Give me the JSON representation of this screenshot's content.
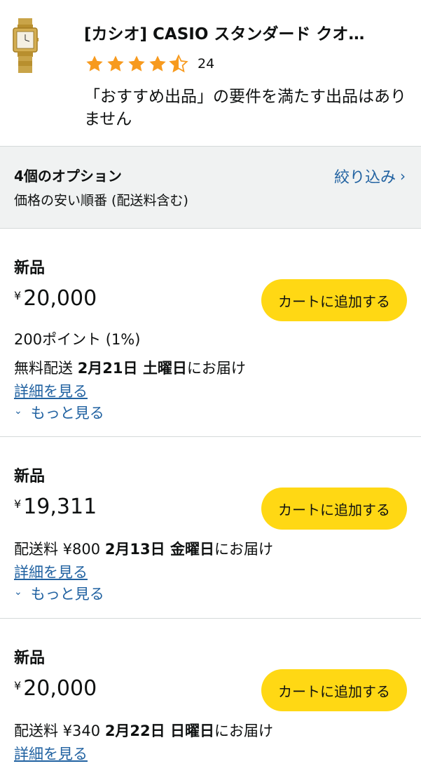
{
  "product": {
    "title": "[カシオ] CASIO スタンダード クオ…",
    "rating_count": "24",
    "rating_value": 4.5,
    "no_recommended": "「おすすめ出品」の要件を満たす出品はありません"
  },
  "options": {
    "count_label": "4個のオプション",
    "sort_label": "価格の安い順番 (配送料含む)",
    "filter_label": "絞り込み"
  },
  "offers": [
    {
      "condition": "新品",
      "currency": "¥",
      "price": "20,000",
      "cart_label": "カートに追加する",
      "points": "200ポイント (1%)",
      "shipping": "無料配送",
      "date": "2月21日 土曜日",
      "suffix": "にお届け",
      "details": "詳細を見る",
      "more": "もっと見る"
    },
    {
      "condition": "新品",
      "currency": "¥",
      "price": "19,311",
      "cart_label": "カートに追加する",
      "shipping": "配送料 ¥800",
      "date": "2月13日 金曜日",
      "suffix": "にお届け",
      "details": "詳細を見る",
      "more": "もっと見る"
    },
    {
      "condition": "新品",
      "currency": "¥",
      "price": "20,000",
      "cart_label": "カートに追加する",
      "shipping": "配送料 ¥340",
      "date": "2月22日 日曜日",
      "suffix": "にお届け",
      "details": "詳細を見る"
    }
  ],
  "colors": {
    "star": "#f79a1e",
    "cart_button": "#ffd814",
    "link": "#2162a1",
    "options_bg": "#f0f2f2"
  },
  "icons": [
    "watch-thumbnail",
    "star-icon",
    "chevron-right-icon",
    "chevron-down-icon"
  ]
}
